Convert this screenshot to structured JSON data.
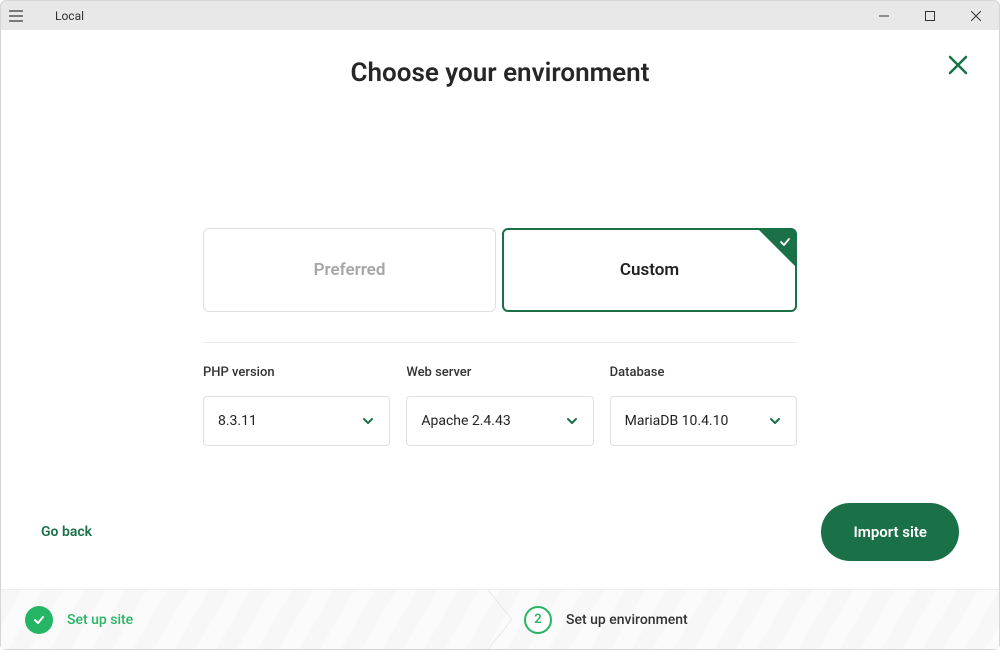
{
  "window": {
    "title": "Local"
  },
  "page": {
    "title": "Choose your environment"
  },
  "env_tiles": {
    "preferred": "Preferred",
    "custom": "Custom"
  },
  "fields": {
    "php": {
      "label": "PHP version",
      "value": "8.3.11"
    },
    "web": {
      "label": "Web server",
      "value": "Apache 2.4.43"
    },
    "database": {
      "label": "Database",
      "value": "MariaDB 10.4.10"
    }
  },
  "actions": {
    "go_back": "Go back",
    "primary": "Import site"
  },
  "steps": {
    "one": {
      "label": "Set up site"
    },
    "two": {
      "number": "2",
      "label": "Set up environment"
    }
  }
}
